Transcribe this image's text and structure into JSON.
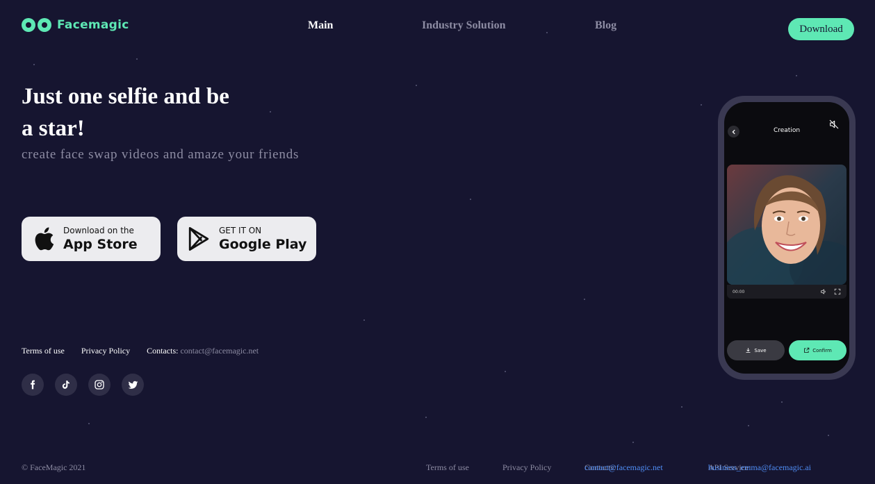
{
  "brand": {
    "name": "Facemagic",
    "accent": "#5ee8b4",
    "background": "#161530"
  },
  "nav": {
    "main": "Main",
    "industry": "Industry Solution",
    "blog": "Blog"
  },
  "header": {
    "download_label": "Download"
  },
  "hero": {
    "title": "Just one selfie and be a star!",
    "subtitle": "create face swap videos and amaze your friends"
  },
  "stores": {
    "apple": {
      "small": "Download on the",
      "big": "App Store"
    },
    "google": {
      "small": "GET IT ON",
      "big": "Google Play"
    }
  },
  "links": {
    "terms": "Terms of use",
    "privacy": "Privacy Policy",
    "contacts_label": "Contacts:",
    "contacts_email": "contact@facemagic.net"
  },
  "socials": [
    "facebook-icon",
    "tiktok-icon",
    "instagram-icon",
    "twitter-icon"
  ],
  "phone": {
    "title": "Creation",
    "time": "00:00",
    "save": "Save",
    "confirm": "Confirm"
  },
  "footer": {
    "copyright": "© FaceMagic 2021",
    "terms": "Terms of use",
    "privacy": "Privacy Policy",
    "contacts_label": "Contacts:",
    "contacts_email": "contact@facemagic.net",
    "api_label": "API Service:",
    "api_email": "business_emma@facemagic.ai"
  }
}
